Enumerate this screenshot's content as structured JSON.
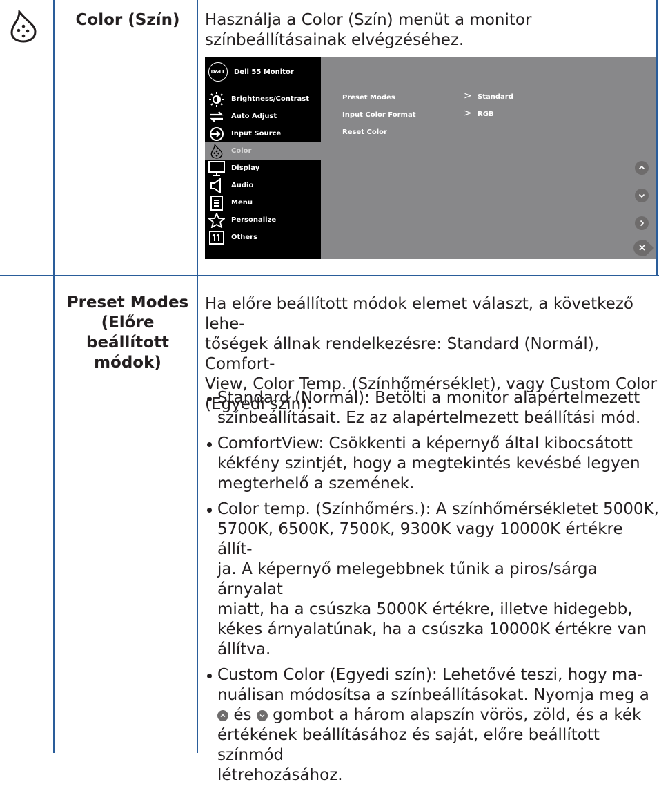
{
  "row1": {
    "label": "Color (Szín)",
    "description": "Használja a Color (Szín) menüt a monitor színbeállításainak elvégzéséhez."
  },
  "osd": {
    "title": "Dell 55 Monitor",
    "logo": "D&LL",
    "menu": [
      {
        "label": "Brightness/Contrast",
        "icon": "brightness-icon"
      },
      {
        "label": "Auto Adjust",
        "icon": "auto-adjust-icon"
      },
      {
        "label": "Input Source",
        "icon": "input-source-icon"
      },
      {
        "label": "Color",
        "icon": "color-icon",
        "selected": true
      },
      {
        "label": "Display",
        "icon": "display-icon"
      },
      {
        "label": "Audio",
        "icon": "audio-icon"
      },
      {
        "label": "Menu",
        "icon": "menu-icon"
      },
      {
        "label": "Personalize",
        "icon": "personalize-icon"
      },
      {
        "label": "Others",
        "icon": "others-icon"
      }
    ],
    "submenu": [
      {
        "label": "Preset Modes",
        "arrow": ">",
        "value": "Standard"
      },
      {
        "label": "Input Color Format",
        "arrow": ">",
        "value": "RGB"
      },
      {
        "label": "Reset Color",
        "arrow": "",
        "value": ""
      }
    ],
    "colors": {
      "menu_bg": "#000000",
      "panel_bg": "#88888a",
      "button": "#6e6c6c"
    }
  },
  "row2": {
    "label_line1": "Preset Modes",
    "label_line2": "(Előre beállított",
    "label_line3": "módok)",
    "intro": [
      "Ha előre beállított módok elemet választ, a következő lehe-",
      "tőségek állnak rendelkezésre: Standard (Normál), Comfort-",
      "View, Color Temp. (Színhőmérséklet), vagy Custom Color",
      "(Egyedi szín)."
    ],
    "bullets": [
      [
        "Standard (Normál): Betölti a monitor alapértelmezett",
        "színbeállításait. Ez az alapértelmezett beállítási mód."
      ],
      [
        "ComfortView: Csökkenti a képernyő által kibocsátott",
        "kékfény szintjét, hogy a megtekintés kevésbé legyen",
        "megterhelő a szemének."
      ],
      [
        "Color temp. (Színhőmérs.): A színhőmérsékletet 5000K,",
        "5700K, 6500K, 7500K, 9300K vagy 10000K értékre állít-",
        "ja. A képernyő melegebbnek tűnik a piros/sárga árnyalat",
        "miatt, ha a csúszka 5000K értékre, illetve hidegebb,",
        "kékes árnyalatúnak, ha a csúszka 10000K értékre van",
        "állítva."
      ]
    ],
    "custom": {
      "line1": "Custom Color (Egyedi szín): Lehetővé teszi, hogy ma-",
      "line2": "nuálisan módosítsa a színbeállításokat. Nyomja meg a",
      "line3_mid": "és",
      "line3_end": "gombot a három alapszín vörös, zöld, és a kék",
      "line4": "értékének beállításához és saját, előre beállított színmód",
      "line5": "létrehozásához."
    }
  }
}
